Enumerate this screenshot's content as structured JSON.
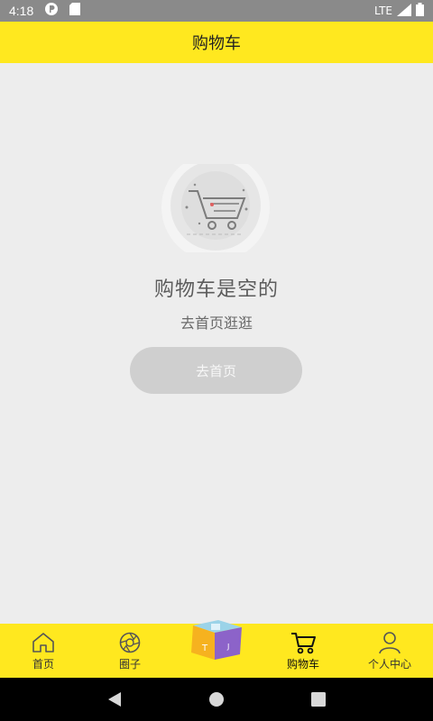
{
  "status_bar": {
    "time": "4:18",
    "network": "LTE",
    "icons": [
      "vpn-icon",
      "sd-card-icon",
      "signal-icon",
      "battery-icon"
    ]
  },
  "header": {
    "title": "购物车"
  },
  "empty_state": {
    "illustration": "empty-cart-illustration",
    "title": "购物车是空的",
    "subtitle": "去首页逛逛",
    "button_label": "去首页"
  },
  "bottom_nav": {
    "active": "cart",
    "items": [
      {
        "key": "home",
        "label": "首页",
        "icon": "home-icon"
      },
      {
        "key": "circle",
        "label": "圈子",
        "icon": "aperture-icon"
      },
      {
        "key": "center",
        "label": "",
        "icon": "cube-logo-icon"
      },
      {
        "key": "cart",
        "label": "购物车",
        "icon": "cart-icon"
      },
      {
        "key": "profile",
        "label": "个人中心",
        "icon": "person-icon"
      }
    ]
  },
  "system_nav": {
    "icons": [
      "back-icon",
      "home-circle-icon",
      "recents-icon"
    ]
  },
  "colors": {
    "accent": "#ffe81f",
    "background": "#ededed",
    "button": "#cfcfcf"
  }
}
